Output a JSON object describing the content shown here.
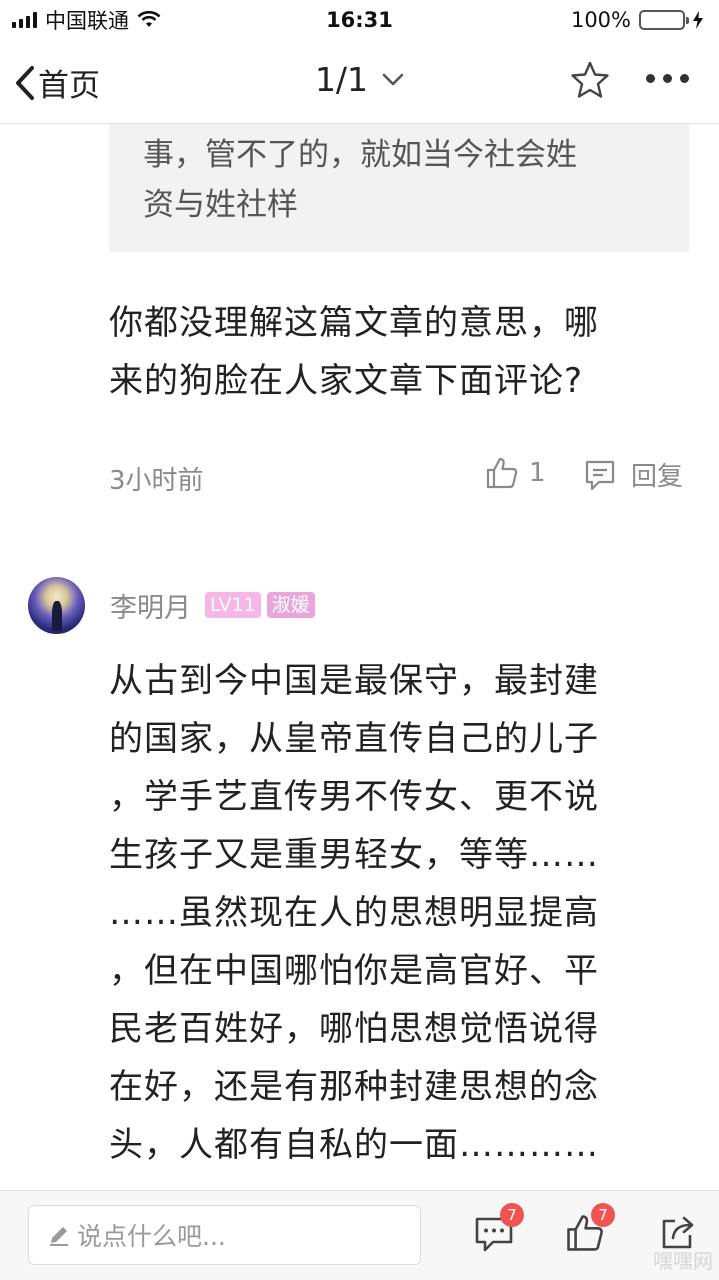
{
  "status_bar": {
    "carrier": "中国联通",
    "time": "16:31",
    "battery": "100%"
  },
  "nav": {
    "back_label": "首页",
    "page_indicator": "1/1"
  },
  "quoted": {
    "lines": [
      "事，管不了的，就如当今社会姓",
      "资与姓社样"
    ]
  },
  "reply": {
    "lines": [
      "你都没理解这篇文章的意思，哪",
      "来的狗脸在人家文章下面评论?"
    ],
    "time": "3小时前",
    "like_count": "1",
    "reply_label": "回复"
  },
  "comment": {
    "username": "李明月",
    "level_badge": "LV11",
    "title_badge": "淑媛",
    "lines": [
      "从古到今中国是最保守，最封建",
      "的国家，从皇帝直传自己的儿子",
      "，学手艺直传男不传女、更不说",
      "生孩子又是重男轻女，等等……",
      "……虽然现在人的思想明显提高",
      "，但在中国哪怕你是高官好、平",
      "民老百姓好，哪怕思想觉悟说得",
      "在好，还是有那种封建思想的念",
      "头，人都有自私的一面…………"
    ]
  },
  "bottom_bar": {
    "input_placeholder": "说点什么吧...",
    "comments_count": "7",
    "likes_count": "7"
  },
  "watermark": "嘿嘿网"
}
